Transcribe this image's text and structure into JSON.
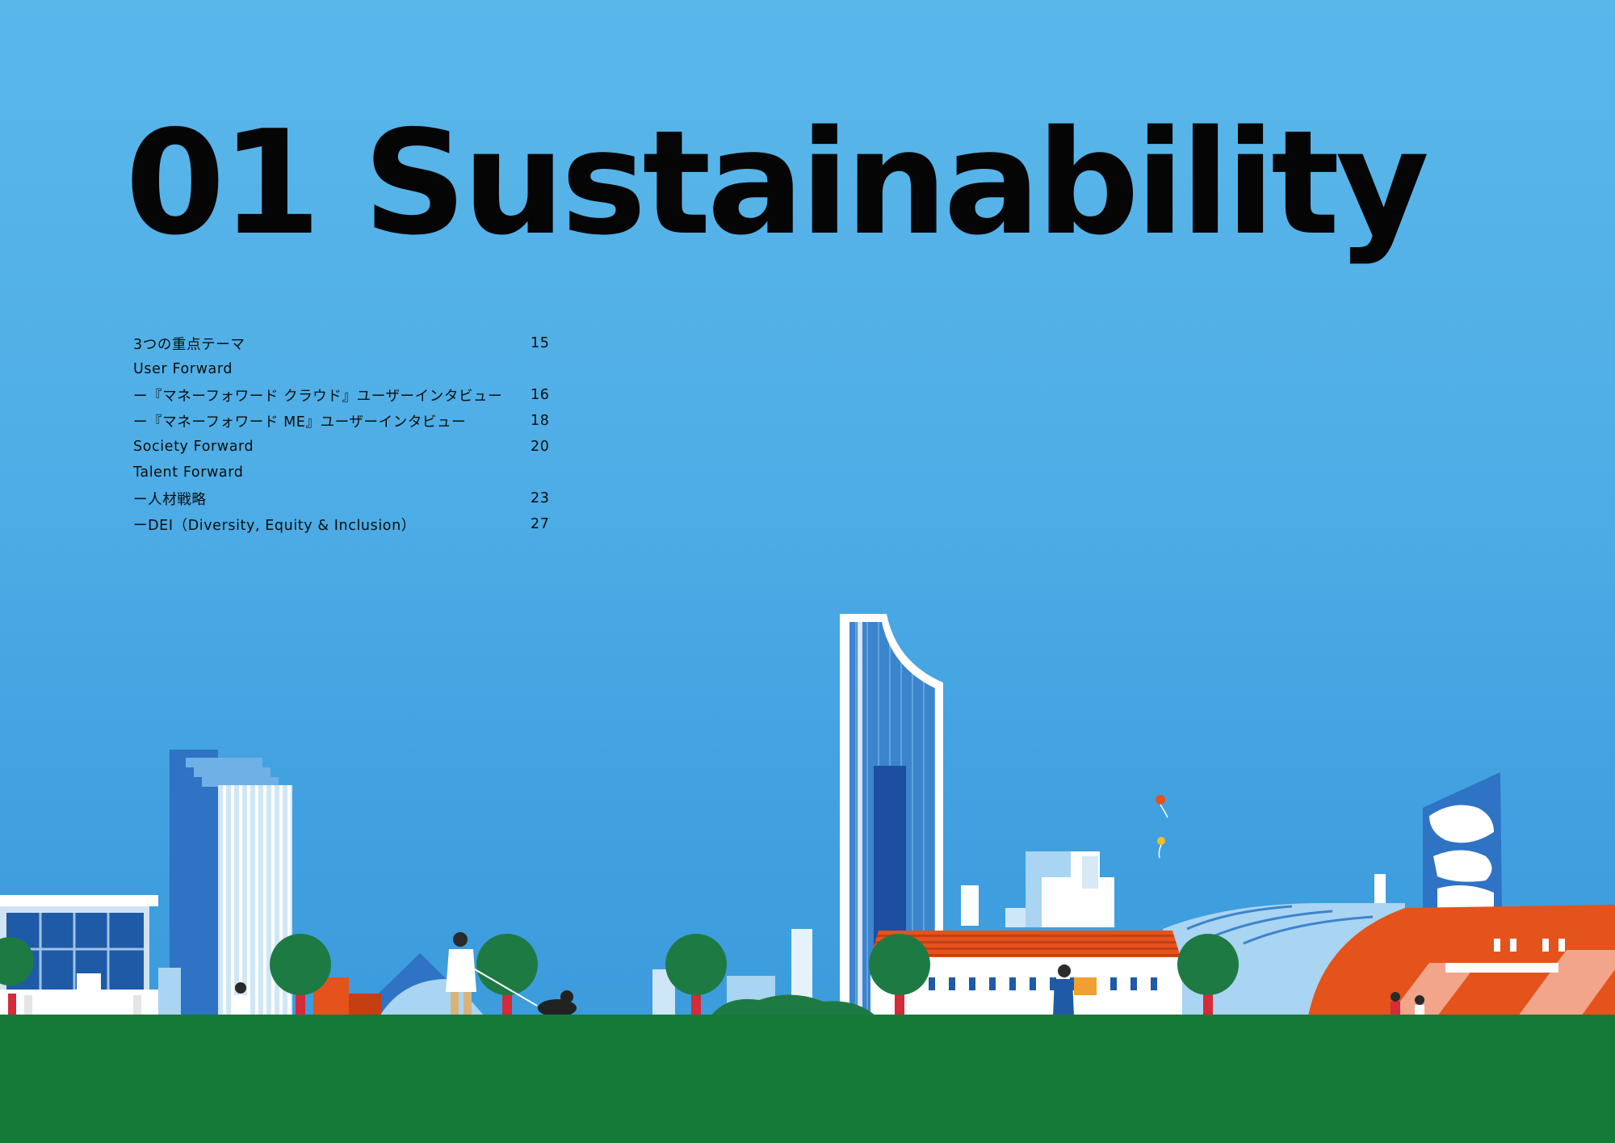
{
  "title": "01 Sustainability",
  "toc": [
    {
      "label": "3つの重点テーマ",
      "page": "15"
    },
    {
      "label": "User Forward",
      "page": ""
    },
    {
      "label": "ー『マネーフォワード クラウド』ユーザーインタビュー",
      "page": "16"
    },
    {
      "label": "ー『マネーフォワード ME』ユーザーインタビュー",
      "page": "18"
    },
    {
      "label": "Society Forward",
      "page": "20"
    },
    {
      "label": "Talent Forward",
      "page": ""
    },
    {
      "label": "ー人材戦略",
      "page": "23"
    },
    {
      "label": "ーDEI（Diversity, Equity & Inclusion）",
      "page": "27"
    }
  ],
  "illustration": {
    "subject": "city-skyline-park",
    "colors": {
      "sky": "#4faee6",
      "grass": "#157a37",
      "building_blue": "#2a6fc0",
      "building_light": "#a9d4f2",
      "roof_orange": "#e4531c",
      "tree": "#1e7a43",
      "trunk": "#d42a3a"
    }
  }
}
